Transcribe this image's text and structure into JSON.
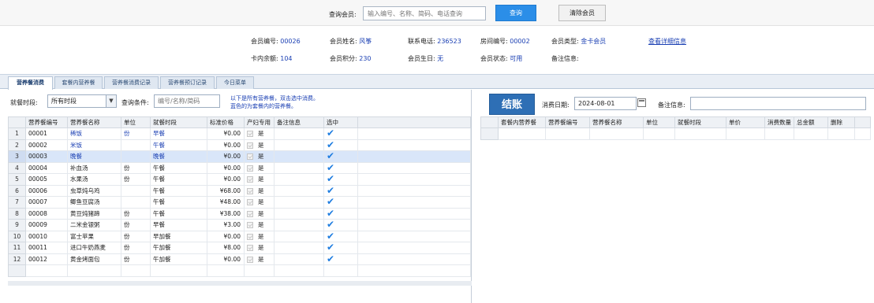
{
  "search": {
    "label": "查询会员:",
    "placeholder": "输入编号、名称、简码、电话查询",
    "query_label": "查询",
    "clear_label": "清除会员"
  },
  "member": {
    "id_label": "会员编号:",
    "id": "00026",
    "name_label": "会员姓名:",
    "name": "风筝",
    "phone_label": "联系电话:",
    "phone": "236523",
    "room_label": "房间编号:",
    "room": "00002",
    "type_label": "会员类型:",
    "type": "金卡会员",
    "detail_link": "查看详细信息",
    "balance_label": "卡内余额:",
    "balance": "104",
    "points_label": "会员积分:",
    "points": "230",
    "birthday_label": "会员生日:",
    "birthday": "无",
    "status_label": "会员状态:",
    "status": "可用",
    "remark_label": "备注信息:",
    "remark": ""
  },
  "tabs": [
    "营养餐消费",
    "套餐内营养餐",
    "营养餐消费记录",
    "营养餐预订记录",
    "今日菜单"
  ],
  "left": {
    "period_label": "就餐时段:",
    "period_value": "所有时段",
    "cond_label": "查询条件:",
    "cond_placeholder": "编号/名称/简码",
    "hint_line1": "以下是所有营养餐，双击选中消费。",
    "hint_line2": "蓝色的为套餐内的营养餐。",
    "columns": [
      "营养餐编号",
      "营养餐名称",
      "单位",
      "就餐时段",
      "标准价格",
      "产妇专用",
      "备注信息",
      "选中"
    ],
    "rows": [
      {
        "no": "1",
        "code": "00001",
        "name": "稀饭",
        "unit": "份",
        "period": "早餐",
        "price": "¥0.00",
        "maternal": "是",
        "remark": "",
        "blue": true
      },
      {
        "no": "2",
        "code": "00002",
        "name": "米饭",
        "unit": "",
        "period": "午餐",
        "price": "¥0.00",
        "maternal": "是",
        "remark": "",
        "blue": true
      },
      {
        "no": "3",
        "code": "00003",
        "name": "晚餐",
        "unit": "",
        "period": "晚餐",
        "price": "¥0.00",
        "maternal": "是",
        "remark": "",
        "blue": true,
        "selected": true
      },
      {
        "no": "4",
        "code": "00004",
        "name": "补血汤",
        "unit": "份",
        "period": "午餐",
        "price": "¥0.00",
        "maternal": "是",
        "remark": ""
      },
      {
        "no": "5",
        "code": "00005",
        "name": "水果汤",
        "unit": "份",
        "period": "午餐",
        "price": "¥0.00",
        "maternal": "是",
        "remark": ""
      },
      {
        "no": "6",
        "code": "00006",
        "name": "虫草炖乌鸡",
        "unit": "",
        "period": "午餐",
        "price": "¥68.00",
        "maternal": "是",
        "remark": ""
      },
      {
        "no": "7",
        "code": "00007",
        "name": "鲫鱼豆腐汤",
        "unit": "",
        "period": "午餐",
        "price": "¥48.00",
        "maternal": "是",
        "remark": ""
      },
      {
        "no": "8",
        "code": "00008",
        "name": "黄豆炖猪蹄",
        "unit": "份",
        "period": "午餐",
        "price": "¥38.00",
        "maternal": "是",
        "remark": ""
      },
      {
        "no": "9",
        "code": "00009",
        "name": "二米金银粥",
        "unit": "份",
        "period": "早餐",
        "price": "¥3.00",
        "maternal": "是",
        "remark": ""
      },
      {
        "no": "10",
        "code": "00010",
        "name": "富士苹果",
        "unit": "份",
        "period": "早加餐",
        "price": "¥0.00",
        "maternal": "是",
        "remark": ""
      },
      {
        "no": "11",
        "code": "00011",
        "name": "进口牛奶燕麦",
        "unit": "份",
        "period": "午加餐",
        "price": "¥8.00",
        "maternal": "是",
        "remark": ""
      },
      {
        "no": "12",
        "code": "00012",
        "name": "黄金烤面包",
        "unit": "份",
        "period": "午加餐",
        "price": "¥0.00",
        "maternal": "是",
        "remark": ""
      }
    ]
  },
  "right": {
    "settle_label": "结账",
    "date_label": "消费日期:",
    "date_value": "2024-08-01",
    "remark_label": "备注信息:",
    "columns": [
      "套餐内营养餐",
      "营养餐编号",
      "营养餐名称",
      "单位",
      "就餐时段",
      "单价",
      "消费数量",
      "总金额",
      "删除"
    ]
  },
  "colors": {
    "accent_blue": "#2b8ee8",
    "settle_blue": "#2e6fb5",
    "link_blue": "#1a3fb3",
    "check_blue": "#1f7de0",
    "selected_row": "#d9e6f9"
  }
}
